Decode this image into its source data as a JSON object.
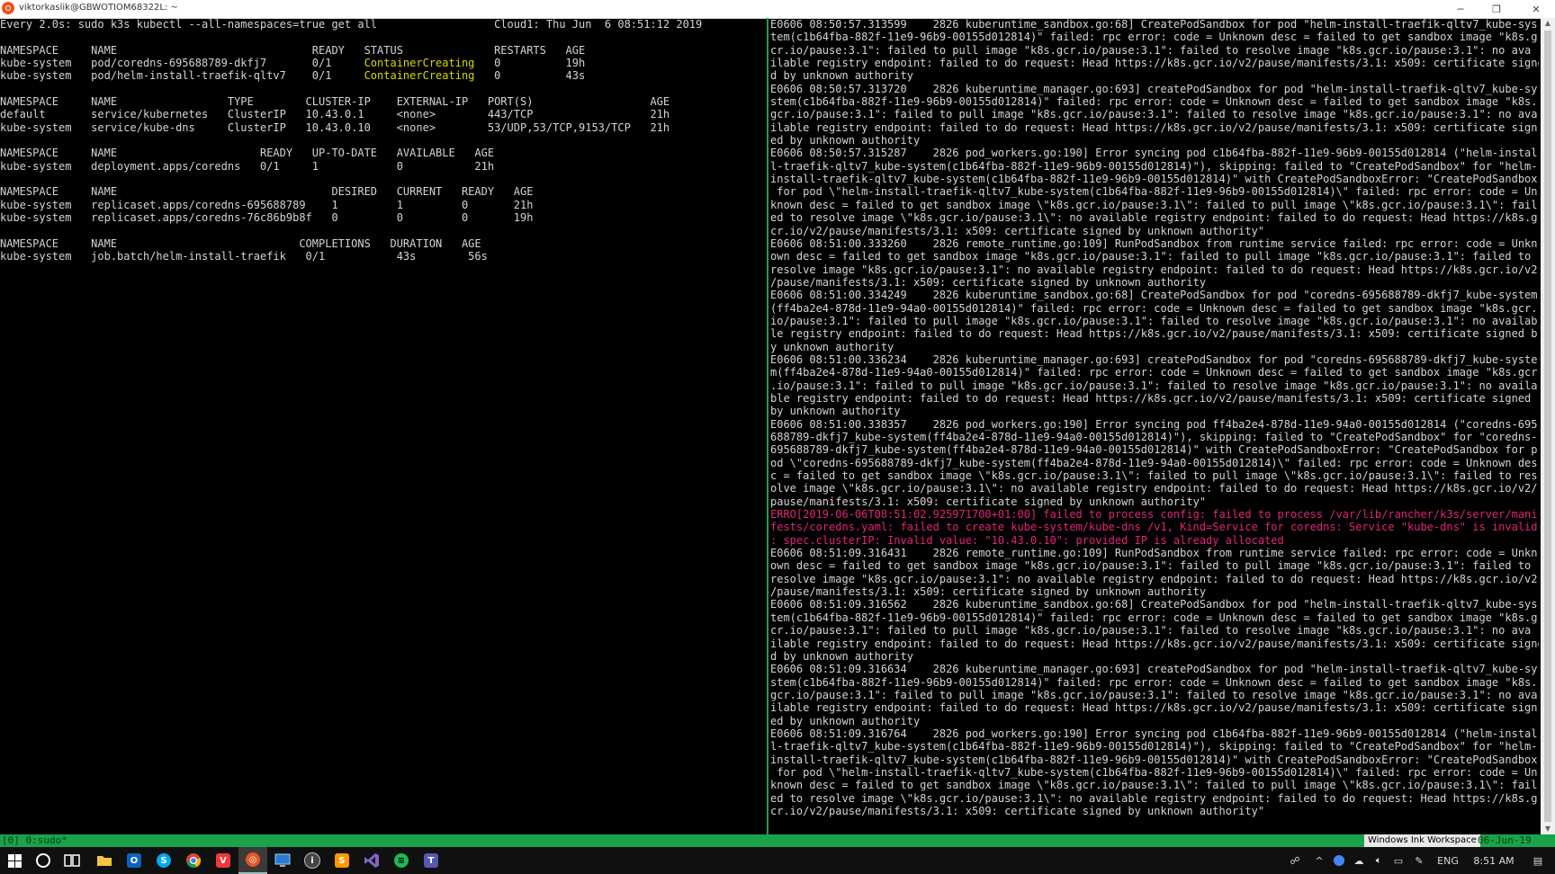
{
  "window": {
    "title": "viktorkaslik@GBWOTIOM68322L: ~",
    "minimize_glyph": "─",
    "restore_glyph": "❐",
    "close_glyph": "✕"
  },
  "left_pane": {
    "watch_header": "Every 2.0s: sudo k3s kubectl --all-namespaces=true get all                  Cloud1: Thu Jun  6 08:51:12 2019",
    "blank": "",
    "pods": {
      "header": "NAMESPACE     NAME                              READY   STATUS              RESTARTS   AGE",
      "rows": [
        {
          "pre": "kube-system   pod/coredns-695688789-dkfj7       0/1     ",
          "status": "ContainerCreating",
          "post": "   0          19h"
        },
        {
          "pre": "kube-system   pod/helm-install-traefik-qltv7    0/1     ",
          "status": "ContainerCreating",
          "post": "   0          43s"
        }
      ]
    },
    "services": {
      "header": "NAMESPACE     NAME                 TYPE        CLUSTER-IP    EXTERNAL-IP   PORT(S)                  AGE",
      "rows": [
        "default       service/kubernetes   ClusterIP   10.43.0.1     <none>        443/TCP                  21h",
        "kube-system   service/kube-dns     ClusterIP   10.43.0.10    <none>        53/UDP,53/TCP,9153/TCP   21h"
      ]
    },
    "deployments": {
      "header": "NAMESPACE     NAME                      READY   UP-TO-DATE   AVAILABLE   AGE",
      "rows": [
        "kube-system   deployment.apps/coredns   0/1     1            0           21h"
      ]
    },
    "replicasets": {
      "header": "NAMESPACE     NAME                                 DESIRED   CURRENT   READY   AGE",
      "rows": [
        "kube-system   replicaset.apps/coredns-695688789    1         1         0       21h",
        "kube-system   replicaset.apps/coredns-76c86b9b8f   0         0         0       19h"
      ]
    },
    "jobs": {
      "header": "NAMESPACE     NAME                            COMPLETIONS   DURATION   AGE",
      "rows": [
        "kube-system   job.batch/helm-install-traefik   0/1           43s        56s"
      ]
    }
  },
  "right_pane": {
    "lines": [
      {
        "text": "E0606 08:50:57.313599    2826 kuberuntime_sandbox.go:68] CreatePodSandbox for pod \"helm-install-traefik-qltv7_kube-sys",
        "color": "normal"
      },
      {
        "text": "tem(c1b64fba-882f-11e9-96b9-00155d012814)\" failed: rpc error: code = Unknown desc = failed to get sandbox image \"k8s.g",
        "color": "normal"
      },
      {
        "text": "cr.io/pause:3.1\": failed to pull image \"k8s.gcr.io/pause:3.1\": failed to resolve image \"k8s.gcr.io/pause:3.1\": no ava",
        "color": "normal"
      },
      {
        "text": "ilable registry endpoint: failed to do request: Head https://k8s.gcr.io/v2/pause/manifests/3.1: x509: certificate signe",
        "color": "normal"
      },
      {
        "text": "d by unknown authority",
        "color": "normal"
      },
      {
        "text": "E0606 08:50:57.313720    2826 kuberuntime_manager.go:693] createPodSandbox for pod \"helm-install-traefik-qltv7_kube-sy",
        "color": "normal"
      },
      {
        "text": "stem(c1b64fba-882f-11e9-96b9-00155d012814)\" failed: rpc error: code = Unknown desc = failed to get sandbox image \"k8s.",
        "color": "normal"
      },
      {
        "text": "gcr.io/pause:3.1\": failed to pull image \"k8s.gcr.io/pause:3.1\": failed to resolve image \"k8s.gcr.io/pause:3.1\": no ava",
        "color": "normal"
      },
      {
        "text": "ilable registry endpoint: failed to do request: Head https://k8s.gcr.io/v2/pause/manifests/3.1: x509: certificate sign",
        "color": "normal"
      },
      {
        "text": "ed by unknown authority",
        "color": "normal"
      },
      {
        "text": "E0606 08:50:57.315287    2826 pod_workers.go:190] Error syncing pod c1b64fba-882f-11e9-96b9-00155d012814 (\"helm-instal",
        "color": "normal"
      },
      {
        "text": "l-traefik-qltv7_kube-system(c1b64fba-882f-11e9-96b9-00155d012814)\"), skipping: failed to \"CreatePodSandbox\" for \"helm-",
        "color": "normal"
      },
      {
        "text": "install-traefik-qltv7_kube-system(c1b64fba-882f-11e9-96b9-00155d012814)\" with CreatePodSandboxError: \"CreatePodSandbox",
        "color": "normal"
      },
      {
        "text": " for pod \\\"helm-install-traefik-qltv7_kube-system(c1b64fba-882f-11e9-96b9-00155d012814)\\\" failed: rpc error: code = Un",
        "color": "normal"
      },
      {
        "text": "known desc = failed to get sandbox image \\\"k8s.gcr.io/pause:3.1\\\": failed to pull image \\\"k8s.gcr.io/pause:3.1\\\": fail",
        "color": "normal"
      },
      {
        "text": "ed to resolve image \\\"k8s.gcr.io/pause:3.1\\\": no available registry endpoint: failed to do request: Head https://k8s.g",
        "color": "normal"
      },
      {
        "text": "cr.io/v2/pause/manifests/3.1: x509: certificate signed by unknown authority\"",
        "color": "normal"
      },
      {
        "text": "E0606 08:51:00.333260    2826 remote_runtime.go:109] RunPodSandbox from runtime service failed: rpc error: code = Unkn",
        "color": "normal"
      },
      {
        "text": "own desc = failed to get sandbox image \"k8s.gcr.io/pause:3.1\": failed to pull image \"k8s.gcr.io/pause:3.1\": failed to",
        "color": "normal"
      },
      {
        "text": "resolve image \"k8s.gcr.io/pause:3.1\": no available registry endpoint: failed to do request: Head https://k8s.gcr.io/v2",
        "color": "normal"
      },
      {
        "text": "/pause/manifests/3.1: x509: certificate signed by unknown authority",
        "color": "normal"
      },
      {
        "text": "E0606 08:51:00.334249    2826 kuberuntime_sandbox.go:68] CreatePodSandbox for pod \"coredns-695688789-dkfj7_kube-system",
        "color": "normal"
      },
      {
        "text": "(ff4ba2e4-878d-11e9-94a0-00155d012814)\" failed: rpc error: code = Unknown desc = failed to get sandbox image \"k8s.gcr.",
        "color": "normal"
      },
      {
        "text": "io/pause:3.1\": failed to pull image \"k8s.gcr.io/pause:3.1\": failed to resolve image \"k8s.gcr.io/pause:3.1\": no availab",
        "color": "normal"
      },
      {
        "text": "le registry endpoint: failed to do request: Head https://k8s.gcr.io/v2/pause/manifests/3.1: x509: certificate signed b",
        "color": "normal"
      },
      {
        "text": "y unknown authority",
        "color": "normal"
      },
      {
        "text": "E0606 08:51:00.336234    2826 kuberuntime_manager.go:693] createPodSandbox for pod \"coredns-695688789-dkfj7_kube-syste",
        "color": "normal"
      },
      {
        "text": "m(ff4ba2e4-878d-11e9-94a0-00155d012814)\" failed: rpc error: code = Unknown desc = failed to get sandbox image \"k8s.gcr",
        "color": "normal"
      },
      {
        "text": ".io/pause:3.1\": failed to pull image \"k8s.gcr.io/pause:3.1\": failed to resolve image \"k8s.gcr.io/pause:3.1\": no availa",
        "color": "normal"
      },
      {
        "text": "ble registry endpoint: failed to do request: Head https://k8s.gcr.io/v2/pause/manifests/3.1: x509: certificate signed",
        "color": "normal"
      },
      {
        "text": "by unknown authority",
        "color": "normal"
      },
      {
        "text": "E0606 08:51:00.338357    2826 pod_workers.go:190] Error syncing pod ff4ba2e4-878d-11e9-94a0-00155d012814 (\"coredns-695",
        "color": "normal"
      },
      {
        "text": "688789-dkfj7_kube-system(ff4ba2e4-878d-11e9-94a0-00155d012814)\"), skipping: failed to \"CreatePodSandbox\" for \"coredns-",
        "color": "normal"
      },
      {
        "text": "695688789-dkfj7_kube-system(ff4ba2e4-878d-11e9-94a0-00155d012814)\" with CreatePodSandboxError: \"CreatePodSandbox for p",
        "color": "normal"
      },
      {
        "text": "od \\\"coredns-695688789-dkfj7_kube-system(ff4ba2e4-878d-11e9-94a0-00155d012814)\\\" failed: rpc error: code = Unknown des",
        "color": "normal"
      },
      {
        "text": "c = failed to get sandbox image \\\"k8s.gcr.io/pause:3.1\\\": failed to pull image \\\"k8s.gcr.io/pause:3.1\\\": failed to res",
        "color": "normal"
      },
      {
        "text": "olve image \\\"k8s.gcr.io/pause:3.1\\\": no available registry endpoint: failed to do request: Head https://k8s.gcr.io/v2/",
        "color": "normal"
      },
      {
        "text": "pause/manifests/3.1: x509: certificate signed by unknown authority\"",
        "color": "normal"
      },
      {
        "text": "ERRO[2019-06-06T08:51:02.925971700+01:00] failed to process config: failed to process /var/lib/rancher/k3s/server/mani",
        "color": "error"
      },
      {
        "text": "fests/coredns.yaml: failed to create kube-system/kube-dns /v1, Kind=Service for coredns: Service \"kube-dns\" is invalid",
        "color": "error"
      },
      {
        "text": ": spec.clusterIP: Invalid value: \"10.43.0.10\": provided IP is already allocated",
        "color": "error"
      },
      {
        "text": "E0606 08:51:09.316431    2826 remote_runtime.go:109] RunPodSandbox from runtime service failed: rpc error: code = Unkn",
        "color": "normal"
      },
      {
        "text": "own desc = failed to get sandbox image \"k8s.gcr.io/pause:3.1\": failed to pull image \"k8s.gcr.io/pause:3.1\": failed to",
        "color": "normal"
      },
      {
        "text": "resolve image \"k8s.gcr.io/pause:3.1\": no available registry endpoint: failed to do request: Head https://k8s.gcr.io/v2",
        "color": "normal"
      },
      {
        "text": "/pause/manifests/3.1: x509: certificate signed by unknown authority",
        "color": "normal"
      },
      {
        "text": "E0606 08:51:09.316562    2826 kuberuntime_sandbox.go:68] CreatePodSandbox for pod \"helm-install-traefik-qltv7_kube-sys",
        "color": "normal"
      },
      {
        "text": "tem(c1b64fba-882f-11e9-96b9-00155d012814)\" failed: rpc error: code = Unknown desc = failed to get sandbox image \"k8s.g",
        "color": "normal"
      },
      {
        "text": "cr.io/pause:3.1\": failed to pull image \"k8s.gcr.io/pause:3.1\": failed to resolve image \"k8s.gcr.io/pause:3.1\": no ava",
        "color": "normal"
      },
      {
        "text": "ilable registry endpoint: failed to do request: Head https://k8s.gcr.io/v2/pause/manifests/3.1: x509: certificate signe",
        "color": "normal"
      },
      {
        "text": "d by unknown authority",
        "color": "normal"
      },
      {
        "text": "E0606 08:51:09.316634    2826 kuberuntime_manager.go:693] createPodSandbox for pod \"helm-install-traefik-qltv7_kube-sy",
        "color": "normal"
      },
      {
        "text": "stem(c1b64fba-882f-11e9-96b9-00155d012814)\" failed: rpc error: code = Unknown desc = failed to get sandbox image \"k8s.",
        "color": "normal"
      },
      {
        "text": "gcr.io/pause:3.1\": failed to pull image \"k8s.gcr.io/pause:3.1\": failed to resolve image \"k8s.gcr.io/pause:3.1\": no ava",
        "color": "normal"
      },
      {
        "text": "ilable registry endpoint: failed to do request: Head https://k8s.gcr.io/v2/pause/manifests/3.1: x509: certificate sign",
        "color": "normal"
      },
      {
        "text": "ed by unknown authority",
        "color": "normal"
      },
      {
        "text": "E0606 08:51:09.316764    2826 pod_workers.go:190] Error syncing pod c1b64fba-882f-11e9-96b9-00155d012814 (\"helm-instal",
        "color": "normal"
      },
      {
        "text": "l-traefik-qltv7_kube-system(c1b64fba-882f-11e9-96b9-00155d012814)\"), skipping: failed to \"CreatePodSandbox\" for \"helm-",
        "color": "normal"
      },
      {
        "text": "install-traefik-qltv7_kube-system(c1b64fba-882f-11e9-96b9-00155d012814)\" with CreatePodSandboxError: \"CreatePodSandbox",
        "color": "normal"
      },
      {
        "text": " for pod \\\"helm-install-traefik-qltv7_kube-system(c1b64fba-882f-11e9-96b9-00155d012814)\\\" failed: rpc error: code = Un",
        "color": "normal"
      },
      {
        "text": "known desc = failed to get sandbox image \\\"k8s.gcr.io/pause:3.1\\\": failed to pull image \\\"k8s.gcr.io/pause:3.1\\\": fail",
        "color": "normal"
      },
      {
        "text": "ed to resolve image \\\"k8s.gcr.io/pause:3.1\\\": no available registry endpoint: failed to do request: Head https://k8s.g",
        "color": "normal"
      },
      {
        "text": "cr.io/v2/pause/manifests/3.1: x509: certificate signed by unknown authority\"",
        "color": "normal"
      }
    ]
  },
  "status_bar": {
    "session": "[0] 0:sudo*",
    "ink_workspace": "Windows Ink Workspace",
    "date": "06-Jun-19"
  },
  "taskbar": {
    "language": "ENG",
    "clock": "8:51 AM"
  },
  "colors": {
    "status_green": "#19a34a",
    "container_creating": "#d7d700",
    "error_text": "#e0237e"
  }
}
